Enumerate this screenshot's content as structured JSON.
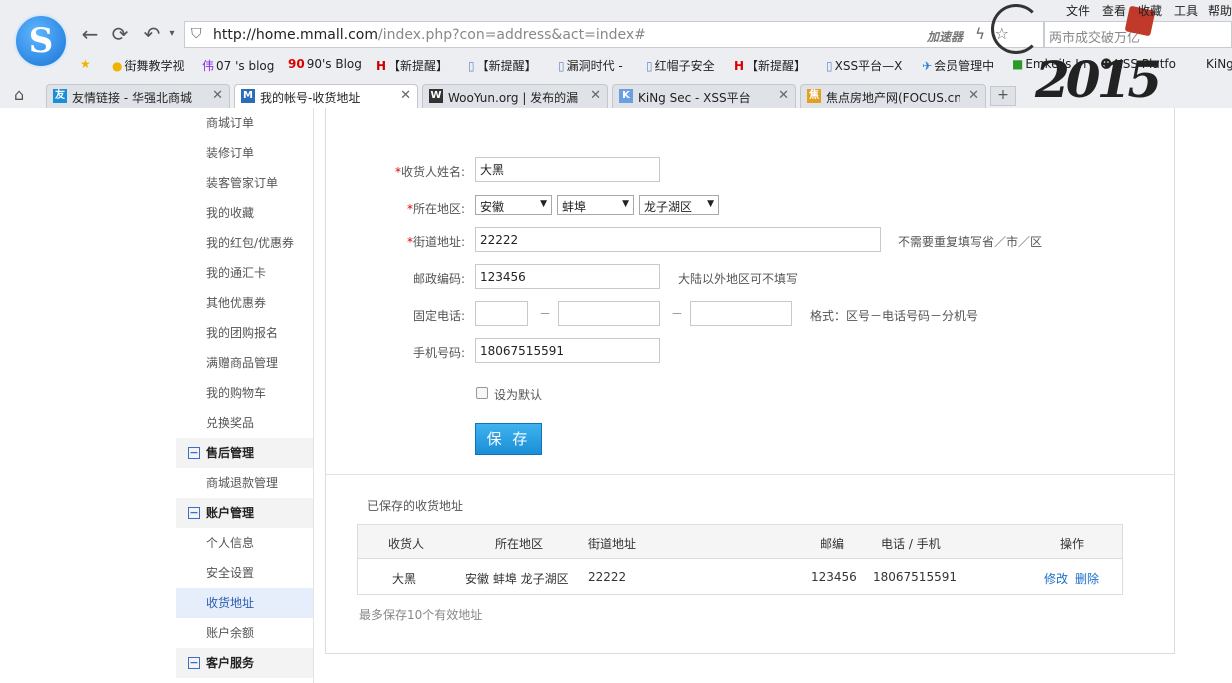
{
  "browser": {
    "menu": [
      "文件",
      "查看",
      "收藏",
      "工具",
      "帮助"
    ],
    "url_host": "http://home.mmall.com",
    "url_path": "/index.php?con=address&act=index#",
    "accelerator": "加速器",
    "search_placeholder": "两市成交破万亿",
    "bookmarks": [
      "街舞教学视",
      "07 's blog",
      "90's Blog",
      "【新提醒】",
      "【新提醒】",
      "漏洞时代 -",
      "红帽子安全",
      "【新提醒】",
      "XSS平台—X",
      "会员管理中",
      "Emkei's In",
      "XSS Platfo",
      "KiNg"
    ],
    "tabs": [
      {
        "title": "友情链接 - 华强北商城",
        "active": false,
        "fav_color": "#1a8fd8",
        "fav_text": "友"
      },
      {
        "title": "我的帐号-收货地址",
        "active": true,
        "fav_color": "#2a6db8",
        "fav_text": "M"
      },
      {
        "title": "WooYun.org | 发布的漏",
        "active": false,
        "fav_color": "#333333",
        "fav_text": "W"
      },
      {
        "title": "KiNg Sec - XSS平台",
        "active": false,
        "fav_color": "#6aa0e0",
        "fav_text": "K"
      },
      {
        "title": "焦点房地产网(FOCUS.cn",
        "active": false,
        "fav_color": "#e0a020",
        "fav_text": "焦"
      }
    ],
    "new_tab": "+",
    "deco_year": "2015"
  },
  "sidebar": {
    "items_top": [
      "商城订单",
      "装修订单",
      "装客管家订单",
      "我的收藏",
      "我的红包/优惠券",
      "我的通汇卡",
      "其他优惠券",
      "我的团购报名",
      "满赠商品管理",
      "我的购物车",
      "兑换奖品"
    ],
    "group_after_sales": "售后管理",
    "after_sales_items": [
      "商城退款管理"
    ],
    "group_account": "账户管理",
    "account_items": [
      "个人信息",
      "安全设置",
      "收货地址",
      "账户余额"
    ],
    "group_service": "客户服务"
  },
  "form": {
    "name_label": "收货人姓名:",
    "name_value": "大黑",
    "region_label": "所在地区:",
    "province": "安徽",
    "city": "蚌埠",
    "district": "龙子湖区",
    "street_label": "街道地址:",
    "street_value": "22222",
    "street_hint": "不需要重复填写省／市／区",
    "zip_label": "邮政编码:",
    "zip_value": "123456",
    "zip_hint": "大陆以外地区可不填写",
    "phone_label": "固定电话:",
    "phone_dash": "－",
    "phone_hint": "格式：区号－电话号码－分机号",
    "mobile_label": "手机号码:",
    "mobile_value": "18067515591",
    "default_label": "设为默认",
    "save_label": "保 存"
  },
  "saved": {
    "title": "已保存的收货地址",
    "headers": [
      "收货人",
      "所在地区",
      "街道地址",
      "邮编",
      "电话 / 手机",
      "操作"
    ],
    "rows": [
      {
        "name": "大黑",
        "region": "安徽  蚌埠  龙子湖区",
        "street": "22222",
        "zip": "123456",
        "phone": "18067515591",
        "edit": "修改",
        "delete": "删除"
      }
    ],
    "footnote": "最多保存10个有效地址"
  }
}
